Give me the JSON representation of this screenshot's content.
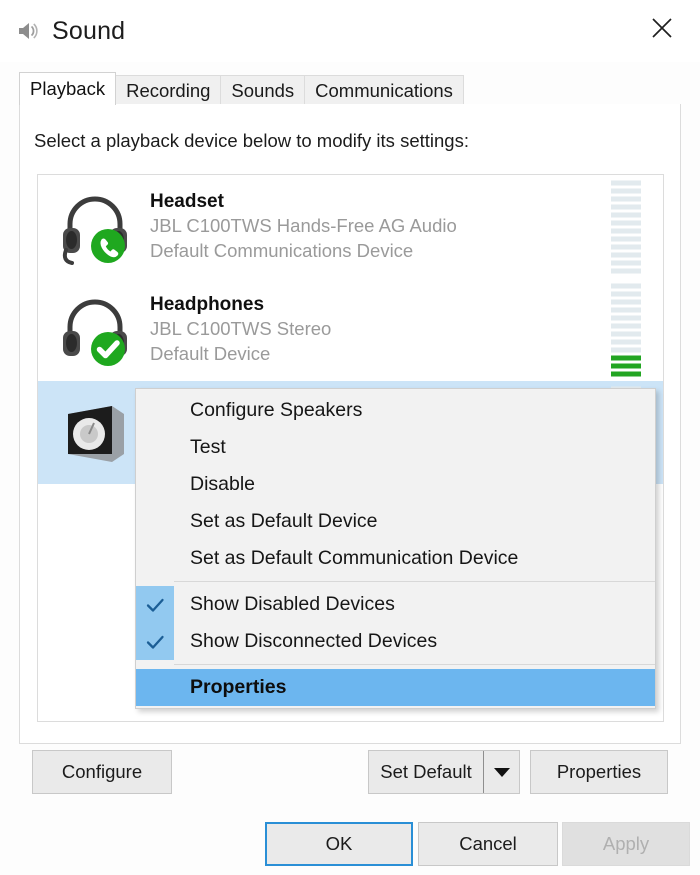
{
  "window": {
    "title": "Sound",
    "icon": "speaker-icon",
    "close_label": "✕"
  },
  "tabs": [
    {
      "label": "Playback",
      "active": true
    },
    {
      "label": "Recording",
      "active": false
    },
    {
      "label": "Sounds",
      "active": false
    },
    {
      "label": "Communications",
      "active": false
    }
  ],
  "panel": {
    "hint": "Select a playback device below to modify its settings:"
  },
  "devices": [
    {
      "icon": "headset-icon",
      "badge": "phone-badge-icon",
      "name": "Headset",
      "description": "JBL C100TWS Hands-Free AG Audio",
      "status": "Default Communications Device",
      "selected": false,
      "meter_segments": 12,
      "meter_active": 0
    },
    {
      "icon": "headphones-icon",
      "badge": "check-badge-icon",
      "name": "Headphones",
      "description": "JBL C100TWS Stereo",
      "status": "Default Device",
      "selected": false,
      "meter_segments": 12,
      "meter_active": 3
    },
    {
      "icon": "speaker-box-icon",
      "badge": "",
      "name": "",
      "description": "",
      "status": "",
      "selected": true,
      "meter_segments": 12,
      "meter_active": 0
    }
  ],
  "context_menu": {
    "items": [
      {
        "label": "Configure Speakers",
        "checked": false,
        "highlight": false,
        "separator_after": false
      },
      {
        "label": "Test",
        "checked": false,
        "highlight": false,
        "separator_after": false
      },
      {
        "label": "Disable",
        "checked": false,
        "highlight": false,
        "separator_after": false
      },
      {
        "label": "Set as Default Device",
        "checked": false,
        "highlight": false,
        "separator_after": false
      },
      {
        "label": "Set as Default Communication Device",
        "checked": false,
        "highlight": false,
        "separator_after": true
      },
      {
        "label": "Show Disabled Devices",
        "checked": true,
        "highlight": false,
        "separator_after": false
      },
      {
        "label": "Show Disconnected Devices",
        "checked": true,
        "highlight": false,
        "separator_after": true
      },
      {
        "label": "Properties",
        "checked": false,
        "highlight": true,
        "separator_after": false
      }
    ]
  },
  "buttons": {
    "configure": "Configure",
    "set_default": "Set Default",
    "properties": "Properties",
    "ok": "OK",
    "cancel": "Cancel",
    "apply": "Apply",
    "apply_disabled": true
  },
  "colors": {
    "selection_blue": "#cce4f7",
    "menu_highlight": "#6cb6ef",
    "check_gutter": "#92c9f0",
    "meter_active": "#22a522",
    "meter_inactive": "#e2eaee",
    "focus_border": "#2a8fd6",
    "badge_green": "#22a522"
  }
}
